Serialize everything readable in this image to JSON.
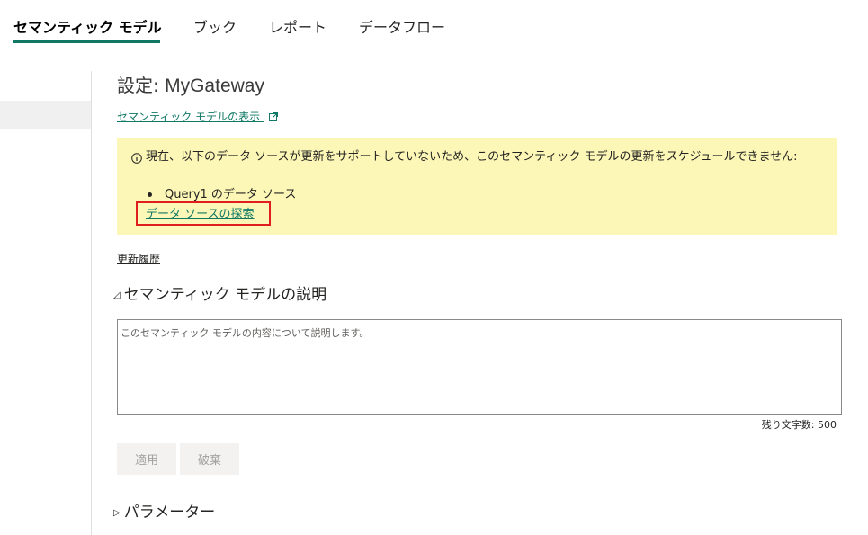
{
  "tabs": [
    {
      "label": "セマンティック モデル",
      "active": true
    },
    {
      "label": "ブック",
      "active": false
    },
    {
      "label": "レポート",
      "active": false
    },
    {
      "label": "データフロー",
      "active": false
    }
  ],
  "settings": {
    "title_prefix": "設定:",
    "gateway_name": "MyGateway",
    "view_link": "セマンティック モデルの表示",
    "view_link_icon": "external-link-icon"
  },
  "warning": {
    "icon": "info-icon",
    "message": "現在、以下のデータ ソースが更新をサポートしていないため、このセマンティック モデルの更新をスケジュールできません:",
    "items": [
      "Query1 のデータ ソース"
    ],
    "explore_link": "データ ソースの探索",
    "background": "#fcf7b6"
  },
  "history_link": "更新履歴",
  "description": {
    "header": "セマンティック モデルの説明",
    "expanded": true,
    "placeholder": "このセマンティック モデルの内容について説明します。",
    "value": "",
    "remaining_label": "残り文字数: 500"
  },
  "buttons": {
    "apply": "適用",
    "discard": "破棄"
  },
  "parameters": {
    "header": "パラメーター",
    "expanded": false
  },
  "colors": {
    "accent": "#117865",
    "highlight_border": "#e01e1e"
  }
}
